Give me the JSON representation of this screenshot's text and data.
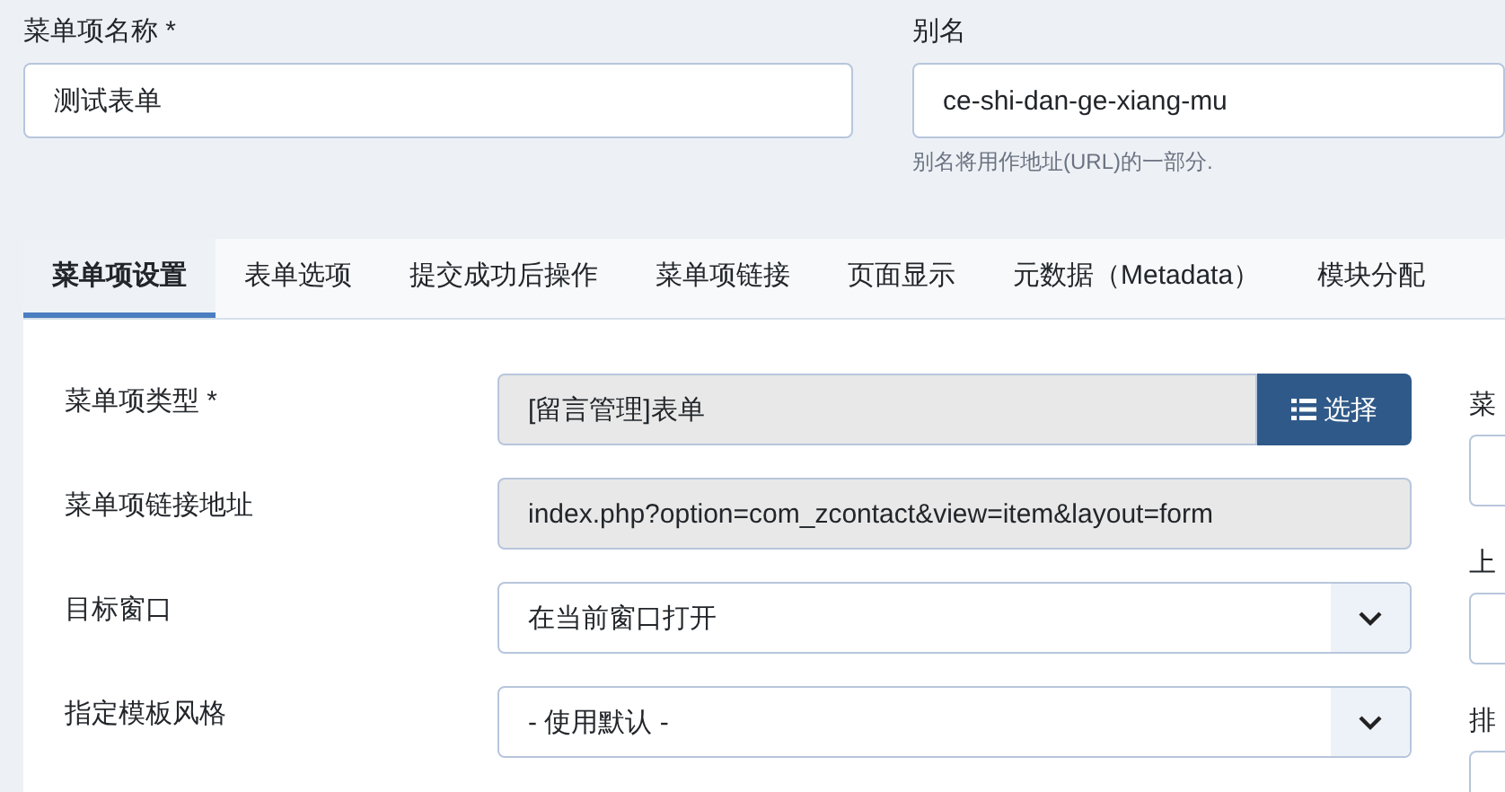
{
  "name_field": {
    "label": "菜单项名称 *",
    "value": "测试表单"
  },
  "alias_field": {
    "label": "别名",
    "value": "ce-shi-dan-ge-xiang-mu",
    "hint": "别名将用作地址(URL)的一部分."
  },
  "tabs": [
    {
      "label": "菜单项设置",
      "selected": true
    },
    {
      "label": "表单选项",
      "selected": false
    },
    {
      "label": "提交成功后操作",
      "selected": false
    },
    {
      "label": "菜单项链接",
      "selected": false
    },
    {
      "label": "页面显示",
      "selected": false
    },
    {
      "label": "元数据（Metadata）",
      "selected": false
    },
    {
      "label": "模块分配",
      "selected": false
    }
  ],
  "settings": [
    {
      "kind": "readonly-button",
      "label": "菜单项类型 *",
      "value": "[留言管理]表单",
      "button": "选择"
    },
    {
      "kind": "readonly",
      "label": "菜单项链接地址",
      "value": "index.php?option=com_zcontact&view=item&layout=form"
    },
    {
      "kind": "select",
      "label": "目标窗口",
      "value": "在当前窗口打开"
    },
    {
      "kind": "select",
      "label": "指定模板风格",
      "value": "- 使用默认 -"
    }
  ],
  "side_fields": [
    {
      "label": "菜"
    },
    {
      "label": "上"
    },
    {
      "label": "排"
    }
  ]
}
